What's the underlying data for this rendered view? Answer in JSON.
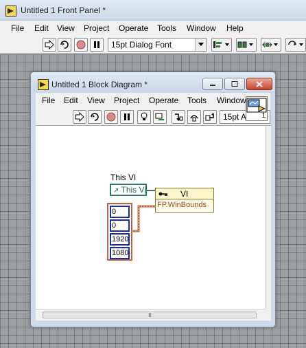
{
  "front_panel": {
    "title": "Untitled 1 Front Panel *",
    "menu": [
      "File",
      "Edit",
      "View",
      "Project",
      "Operate",
      "Tools",
      "Window",
      "Help"
    ],
    "font_dropdown": "15pt Dialog Font"
  },
  "block_diagram": {
    "title": "Untitled 1 Block Diagram *",
    "menu": [
      "File",
      "Edit",
      "View",
      "Project",
      "Operate",
      "Tools",
      "Window"
    ],
    "font_dropdown": "15pt A",
    "vi_icon_number": "1",
    "this_vi_label": "This VI",
    "this_vi_node": "This VI",
    "property_node_class": "VI",
    "property_node_field": "FP.WinBounds",
    "array_values": [
      "0",
      "0",
      "1920",
      "1080"
    ],
    "scroll_grip": "III"
  },
  "colors": {
    "run_red": "#c0392b",
    "ref_wire_green": "#2e7d5a",
    "array_orange": "#b5653b",
    "int_blue": "#1b2ba6",
    "property_node_bg": "#fffde9"
  },
  "icons": [
    "labview-vi-icon",
    "run-arrow-icon",
    "run-continuous-icon",
    "abort-icon",
    "pause-icon",
    "highlight-execution-icon",
    "retain-wire-values-icon",
    "step-into-icon",
    "step-over-icon",
    "step-out-icon",
    "align-icon",
    "distribute-icon",
    "resize-icon",
    "reorder-icon"
  ]
}
